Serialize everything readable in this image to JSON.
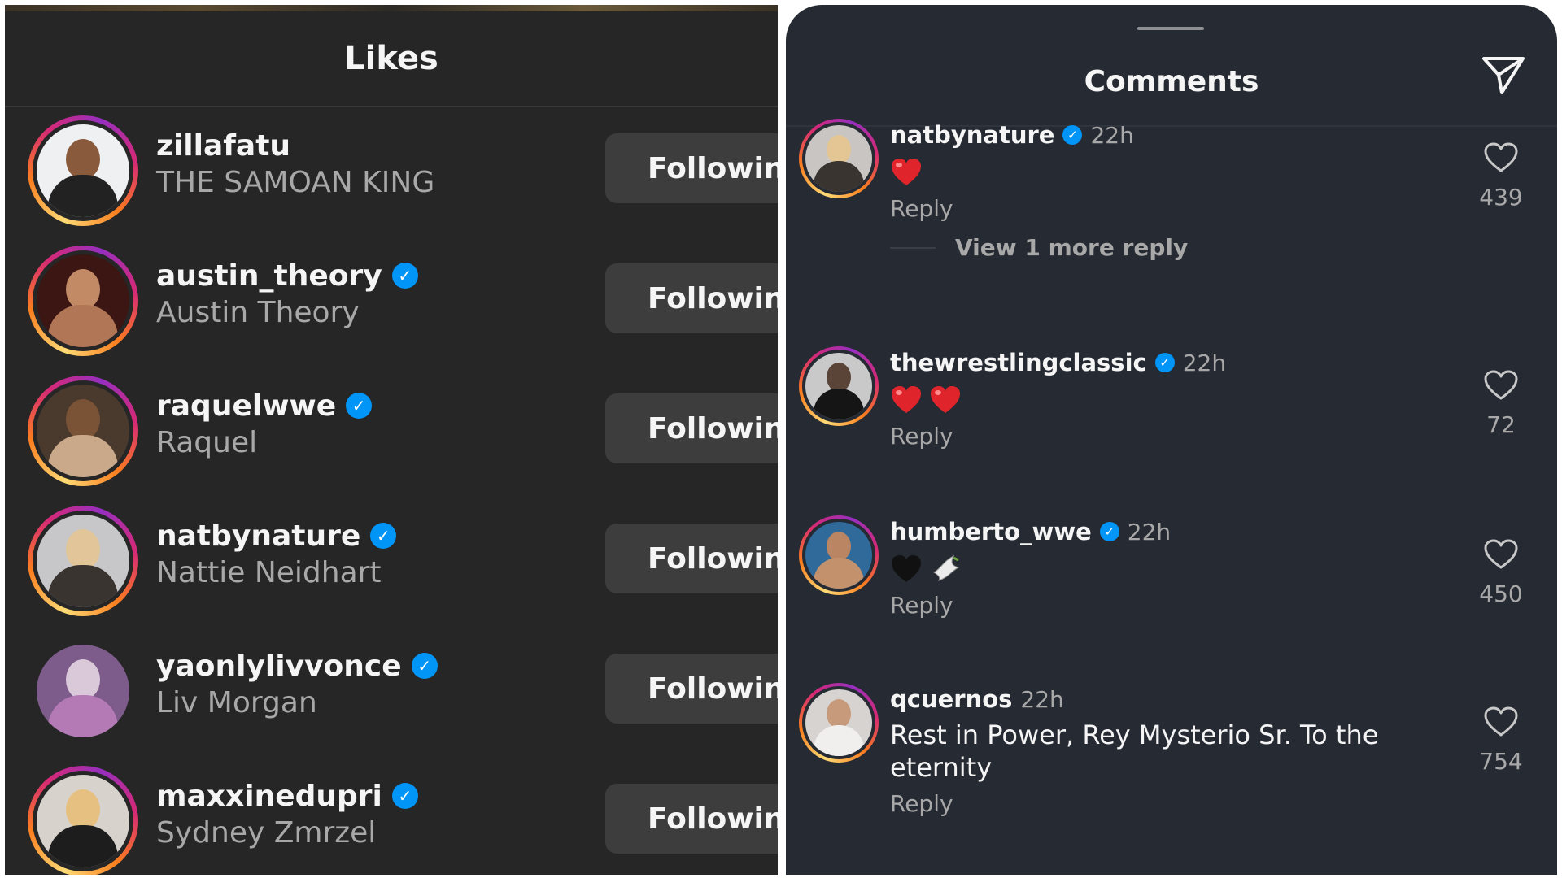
{
  "likes": {
    "title": "Likes",
    "button_label": "Following",
    "users": [
      {
        "username": "zillafatu",
        "full_name": "THE SAMOAN KING",
        "verified": false,
        "story_ring": true,
        "avatar_colors": {
          "bg": "#eef0f2",
          "head": "#8a5a3c",
          "body": "#222222"
        }
      },
      {
        "username": "austin_theory",
        "full_name": "Austin Theory",
        "verified": true,
        "story_ring": true,
        "avatar_colors": {
          "bg": "#3b1612",
          "head": "#c38a66",
          "body": "#b07656"
        }
      },
      {
        "username": "raquelwwe",
        "full_name": "Raquel",
        "verified": true,
        "story_ring": true,
        "avatar_colors": {
          "bg": "#4a3a2e",
          "head": "#7a5236",
          "body": "#c9a98a"
        }
      },
      {
        "username": "natbynature",
        "full_name": "Nattie Neidhart",
        "verified": true,
        "story_ring": true,
        "avatar_colors": {
          "bg": "#c7c7c9",
          "head": "#e2c69a",
          "body": "#3a3430"
        }
      },
      {
        "username": "yaonlylivvonce",
        "full_name": "Liv Morgan",
        "verified": true,
        "story_ring": false,
        "avatar_colors": {
          "bg": "#7d5c8c",
          "head": "#d9c9d9",
          "body": "#b37ab5"
        }
      },
      {
        "username": "maxxinedupri",
        "full_name": "Sydney Zmrzel",
        "verified": true,
        "story_ring": true,
        "avatar_colors": {
          "bg": "#d8d2cc",
          "head": "#e6c080",
          "body": "#1d1d1d"
        }
      }
    ]
  },
  "comments": {
    "title": "Comments",
    "reply_label": "Reply",
    "view_more_label": "View 1 more reply",
    "items": [
      {
        "username": "natbynature",
        "verified": true,
        "time": "22h",
        "text": "",
        "emojis": [
          "red-heart"
        ],
        "likes": "439",
        "avatar_colors": {
          "bg": "#c9c5c2",
          "head": "#e3c693",
          "body": "#3a3430"
        }
      },
      {
        "username": "thewrestlingclassic",
        "verified": true,
        "time": "22h",
        "text": "",
        "emojis": [
          "red-heart",
          "red-heart"
        ],
        "likes": "72",
        "avatar_colors": {
          "bg": "#c9c9c9",
          "head": "#5a4438",
          "body": "#151515"
        }
      },
      {
        "username": "humberto_wwe",
        "verified": true,
        "time": "22h",
        "text": "",
        "emojis": [
          "black-heart",
          "dove"
        ],
        "likes": "450",
        "avatar_colors": {
          "bg": "#2f6a9a",
          "head": "#b98563",
          "body": "#c4916d"
        }
      },
      {
        "username": "qcuernos",
        "verified": false,
        "time": "22h",
        "text": "Rest in Power, Rey Mysterio Sr. To the eternity",
        "emojis": [],
        "likes": "754",
        "avatar_colors": {
          "bg": "#d6d3d0",
          "head": "#c79a7c",
          "body": "#f0efee"
        }
      }
    ]
  },
  "colors": {
    "likes_bg": "#262626",
    "comments_bg": "#262a33",
    "button_bg": "#3d3d3d",
    "verified_blue": "#0095f6",
    "secondary_text": "#a8a8a8"
  },
  "icons": {
    "verified": "verified-badge-icon",
    "send": "paper-plane-icon",
    "like": "heart-outline-icon"
  }
}
